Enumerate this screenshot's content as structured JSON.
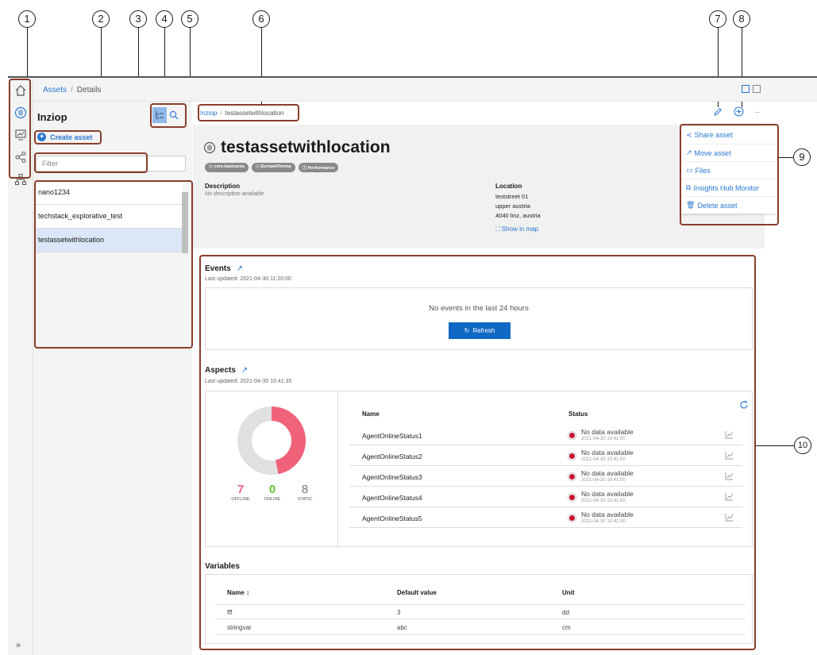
{
  "callouts": [
    "1",
    "2",
    "3",
    "4",
    "5",
    "6",
    "7",
    "8",
    "9",
    "10"
  ],
  "topbar": {
    "breadcrumb_root": "Assets",
    "breadcrumb_current": "Details"
  },
  "left_panel": {
    "title": "Inziop",
    "create_label": "Create asset",
    "filter_placeholder": "Filter",
    "assets": [
      "nano1234",
      "techstack_explorative_test",
      "testassetwithlocation"
    ],
    "selected_index": 2
  },
  "main": {
    "breadcrumb_root": "Inziop",
    "breadcrumb_current": "testassetwithlocation",
    "title": "testassetwithlocation",
    "tags": [
      "core.basicarea",
      "Europe/Vienna",
      "Performance"
    ],
    "description_label": "Description",
    "description_value": "No description available",
    "location_label": "Location",
    "location_lines": [
      "teststreet 01",
      "upper austria",
      "4040 linz, austria"
    ],
    "show_in_map": "Show in map"
  },
  "menu": {
    "items": [
      "Share asset",
      "Move asset",
      "Files",
      "Insights Hub Monitor",
      "Delete asset"
    ]
  },
  "events": {
    "title": "Events",
    "last_updated": "Last updated: 2021-04-30 11:20:00",
    "empty_text": "No events in the last 24 hours",
    "refresh_label": "Refresh"
  },
  "aspects": {
    "title": "Aspects",
    "last_updated": "Last updated: 2021-04-30 10:41:35",
    "offline": {
      "value": "7",
      "label": "OFFLINE",
      "color": "#f0627a"
    },
    "online": {
      "value": "0",
      "label": "ONLINE",
      "color": "#5ac13d"
    },
    "static": {
      "value": "8",
      "label": "STATIC",
      "color": "#777777"
    },
    "col_name": "Name",
    "col_status": "Status",
    "rows": [
      {
        "name": "AgentOnlineStatus1",
        "status": "No data available",
        "time": "2021-04-30 10:41:00"
      },
      {
        "name": "AgentOnlineStatus2",
        "status": "No data available",
        "time": "2021-04-30 10:41:00"
      },
      {
        "name": "AgentOnlineStatus3",
        "status": "No data available",
        "time": "2021-04-30 10:41:00"
      },
      {
        "name": "AgentOnlineStatus4",
        "status": "No data available",
        "time": "2021-04-30 10:41:00"
      },
      {
        "name": "AgentOnlineStatus5",
        "status": "No data available",
        "time": "2021-04-30 10:41:00"
      }
    ]
  },
  "variables": {
    "title": "Variables",
    "col_name": "Name ↕",
    "col_default": "Default value",
    "col_unit": "Unit",
    "rows": [
      {
        "name": "fff",
        "default": "3",
        "unit": "dd"
      },
      {
        "name": "stringvar",
        "default": "abc",
        "unit": "cm"
      }
    ]
  },
  "colors": {
    "accent": "#2877d0",
    "highlight": "#8a3d2b",
    "offline": "#f0627a",
    "static_ring": "#e0e0e0"
  }
}
